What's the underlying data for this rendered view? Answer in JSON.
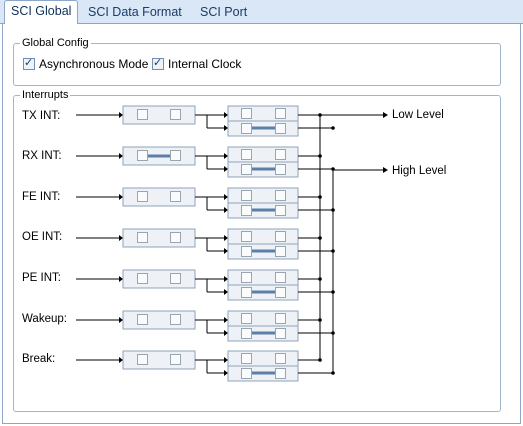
{
  "tabs": [
    "SCI Global",
    "SCI Data Format",
    "SCI Port"
  ],
  "global_config": {
    "title": "Global Config",
    "async_label": "Asynchronous Mode",
    "async_checked": true,
    "clock_label": "Internal Clock",
    "clock_checked": true
  },
  "interrupts": {
    "title": "Interrupts",
    "rows": [
      {
        "label": "TX INT:",
        "first_mux_linked": false,
        "second_mux_linked": true
      },
      {
        "label": "RX INT:",
        "first_mux_linked": true,
        "second_mux_linked": true
      },
      {
        "label": "FE INT:",
        "first_mux_linked": false,
        "second_mux_linked": true
      },
      {
        "label": "OE INT:",
        "first_mux_linked": false,
        "second_mux_linked": true
      },
      {
        "label": "PE INT:",
        "first_mux_linked": false,
        "second_mux_linked": true
      },
      {
        "label": "Wakeup:",
        "first_mux_linked": false,
        "second_mux_linked": true
      },
      {
        "label": "Break:",
        "first_mux_linked": false,
        "second_mux_linked": true
      }
    ],
    "outputs": {
      "low": "Low Level",
      "high": "High Level"
    }
  },
  "colors": {
    "accent": "#5b7fa8",
    "border": "#9fb6cf",
    "tab_bg": "#d9e7f7"
  }
}
